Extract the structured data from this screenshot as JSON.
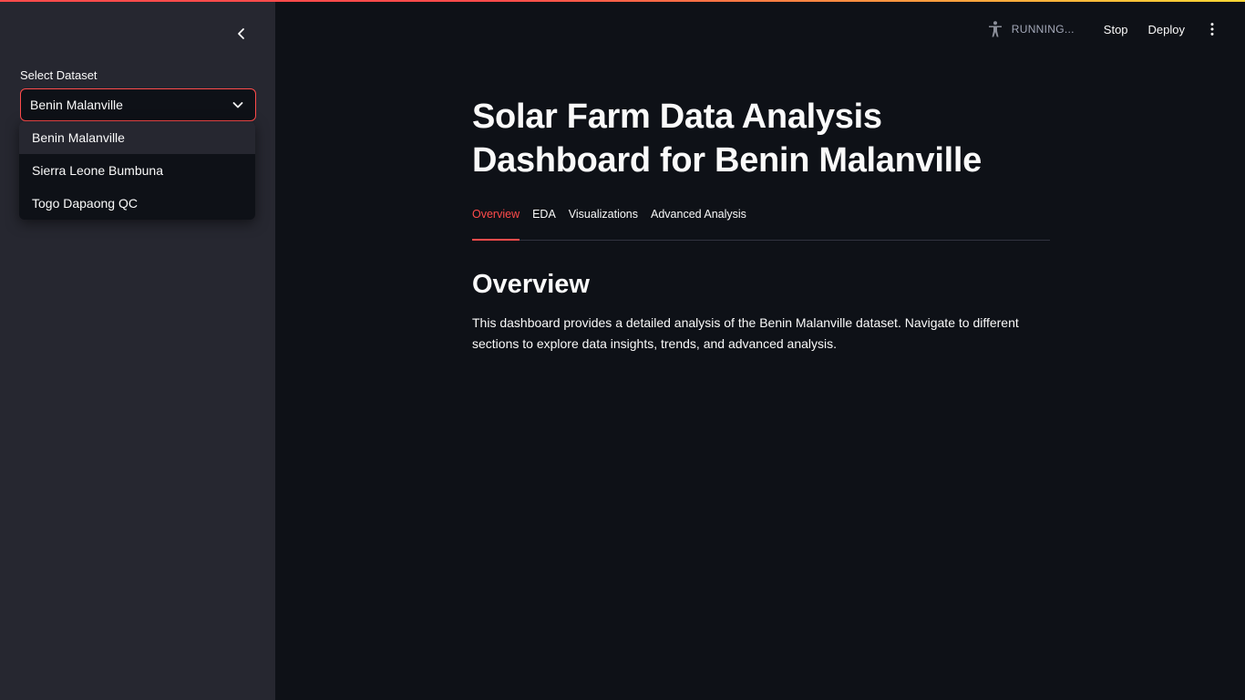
{
  "sidebar": {
    "select_label": "Select Dataset",
    "selected_value": "Benin Malanville",
    "options": [
      "Benin Malanville",
      "Sierra Leone Bumbuna",
      "Togo Dapaong QC"
    ]
  },
  "header": {
    "running_text": "RUNNING...",
    "stop_label": "Stop",
    "deploy_label": "Deploy"
  },
  "main": {
    "title": "Solar Farm Data Analysis Dashboard for Benin Malanville",
    "tabs": [
      {
        "label": "Overview"
      },
      {
        "label": "EDA"
      },
      {
        "label": "Visualizations"
      },
      {
        "label": "Advanced Analysis"
      }
    ],
    "section_heading": "Overview",
    "description": "This dashboard provides a detailed analysis of the Benin Malanville dataset. Navigate to different sections to explore data insights, trends, and advanced analysis."
  },
  "colors": {
    "accent": "#ff4b4b",
    "background": "#0e1117",
    "sidebar": "#262730"
  },
  "icons": {
    "collapse": "chevron-left-icon",
    "select_arrow": "chevron-down-icon",
    "running": "running-person-icon",
    "menu": "kebab-menu-icon"
  }
}
